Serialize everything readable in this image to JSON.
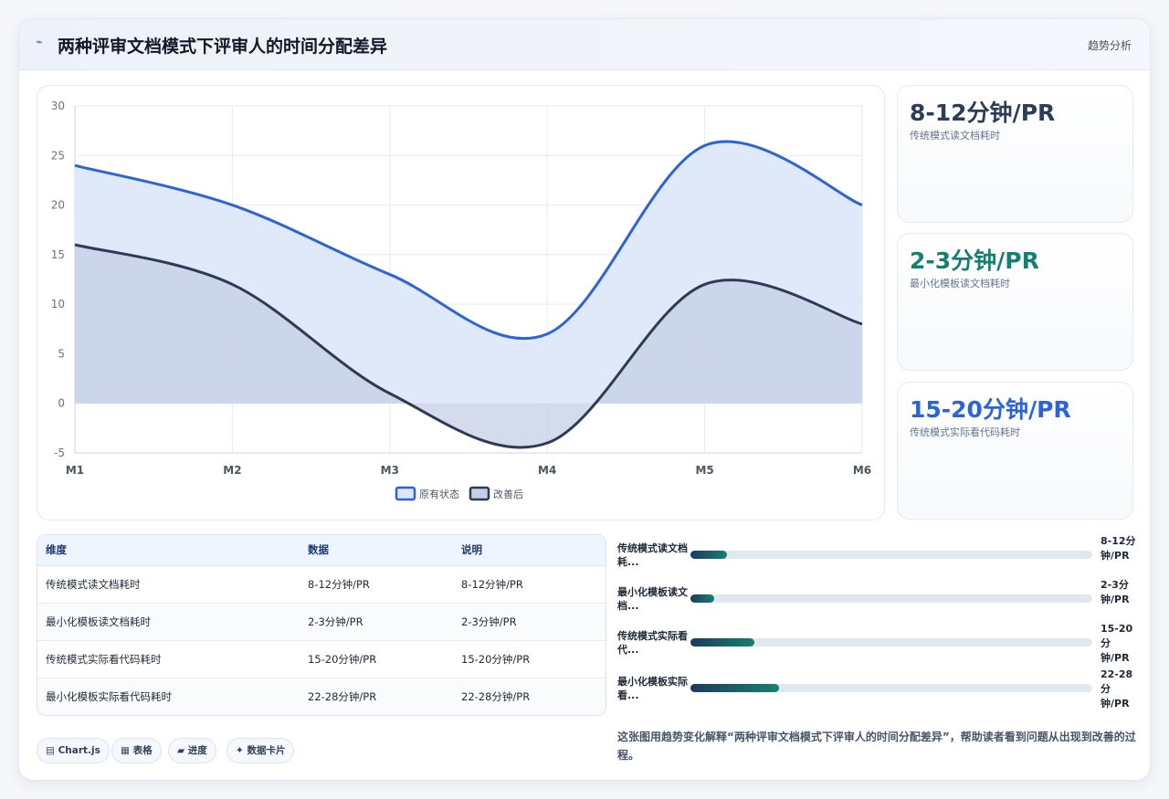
{
  "header": {
    "icon": "chart-icon",
    "title": "两种评审文档模式下评审人的时间分配差异",
    "tag": "趋势分析"
  },
  "chart_data": {
    "type": "area",
    "categories": [
      "M1",
      "M2",
      "M3",
      "M4",
      "M5",
      "M6"
    ],
    "series": [
      {
        "name": "原有状态",
        "values": [
          24,
          20,
          13,
          7,
          26,
          20
        ],
        "color": "#2d63d8",
        "fill": "#dde7f9"
      },
      {
        "name": "改善后",
        "values": [
          16,
          12,
          1,
          -4,
          12,
          8
        ],
        "color": "#2d3b55",
        "fill": "#c5cfe5"
      }
    ],
    "ylim": [
      -5,
      30
    ],
    "yticks": [
      -5,
      0,
      5,
      10,
      15,
      20,
      25,
      30
    ],
    "grid": true,
    "legend": "bottom"
  },
  "stats": [
    {
      "value": "8-12分钟/PR",
      "label": "传统模式读文档耗时",
      "color": "#2c3e56"
    },
    {
      "value": "2-3分钟/PR",
      "label": "最小化模板读文档耗时",
      "color": "#15806f"
    },
    {
      "value": "15-20分钟/PR",
      "label": "传统模式实际看代码耗时",
      "color": "#2d63d8"
    }
  ],
  "table": {
    "headers": [
      "维度",
      "数据",
      "说明"
    ],
    "rows": [
      [
        "传统模式读文档耗时",
        "8-12分钟/PR",
        "8-12分钟/PR"
      ],
      [
        "最小化模板读文档耗时",
        "2-3分钟/PR",
        "2-3分钟/PR"
      ],
      [
        "传统模式实际看代码耗时",
        "15-20分钟/PR",
        "15-20分钟/PR"
      ],
      [
        "最小化模板实际看代码耗时",
        "22-28分钟/PR",
        "22-28分钟/PR"
      ]
    ]
  },
  "progress": [
    {
      "label": "传统模式读文档耗...",
      "value": "8-12分钟/PR",
      "fraction": 0.09
    },
    {
      "label": "最小化模板读文档...",
      "value": "2-3分钟/PR",
      "fraction": 0.06
    },
    {
      "label": "传统模式实际看代...",
      "value": "15-20分钟/PR",
      "fraction": 0.16
    },
    {
      "label": "最小化模板实际看...",
      "value": "22-28分钟/PR",
      "fraction": 0.22
    }
  ],
  "chips": [
    {
      "icon": "table-icon",
      "glyph": "▤",
      "label": "Chart.js"
    },
    {
      "icon": "grid-icon",
      "glyph": "▦",
      "label": "表格"
    },
    {
      "icon": "progress-icon",
      "glyph": "▰",
      "label": "进度"
    },
    {
      "icon": "sparkle-icon",
      "glyph": "✦",
      "label": "数据卡片"
    }
  ],
  "caption": "这张图用趋势变化解释“两种评审文档模式下评审人的时间分配差异”，帮助读者看到问题从出现到改善的过程。"
}
